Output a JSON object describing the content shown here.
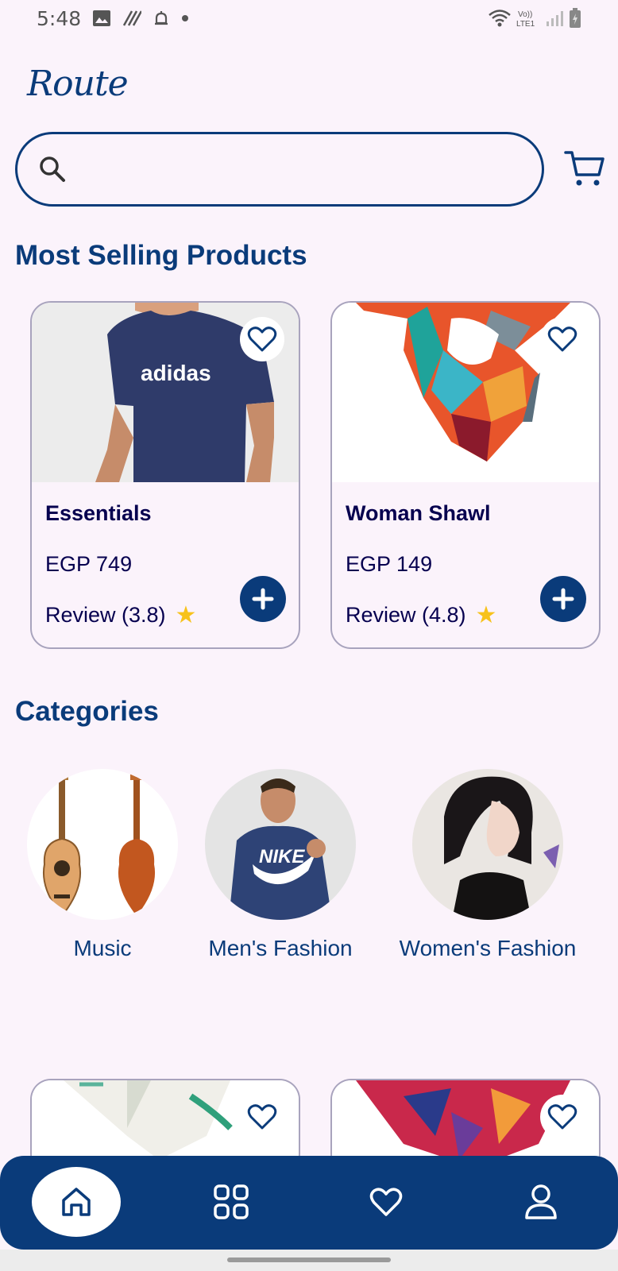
{
  "status_bar": {
    "time": "5:48"
  },
  "app": {
    "logo": "Route"
  },
  "search": {
    "placeholder": ""
  },
  "most_selling": {
    "title": "Most Selling Products",
    "products": [
      {
        "name": "Essentials",
        "price": "EGP 749",
        "review": "Review (3.8)"
      },
      {
        "name": "Woman Shawl",
        "price": "EGP 149",
        "review": "Review (4.8)"
      }
    ]
  },
  "categories": {
    "title": "Categories",
    "items": [
      {
        "label": "Music"
      },
      {
        "label": "Men's Fashion"
      },
      {
        "label": "Women's Fashion"
      }
    ]
  },
  "bottom_nav": {
    "items": [
      "home-icon",
      "categories-grid-icon",
      "heart-icon",
      "user-icon"
    ],
    "active": "home-icon"
  },
  "colors": {
    "primary": "#0a3b7a",
    "background": "#fbf3fb",
    "text": "#06004f",
    "star": "#f7c21b"
  }
}
